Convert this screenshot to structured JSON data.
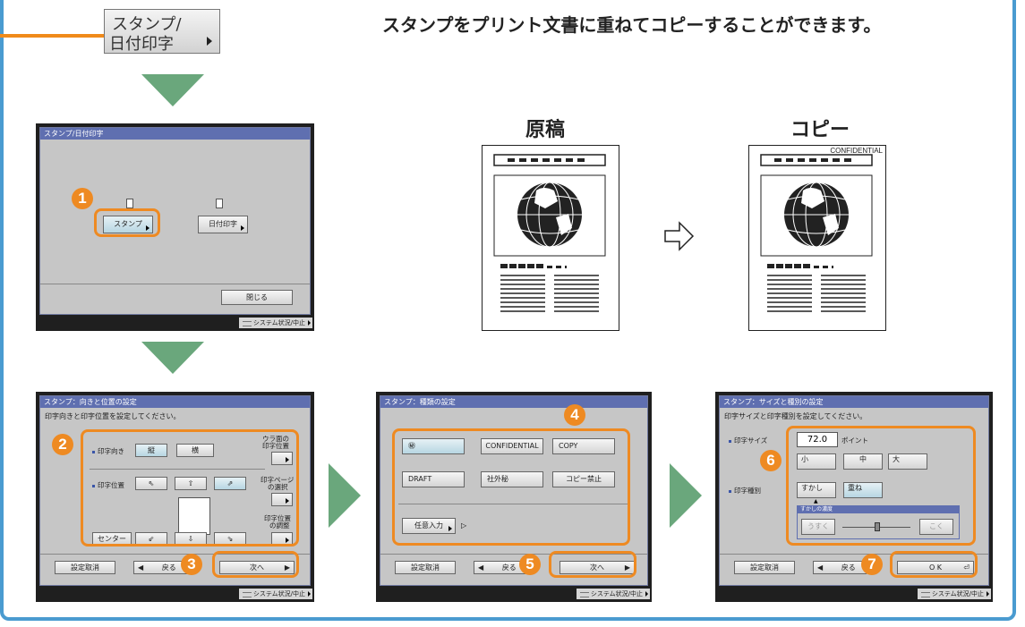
{
  "top": {
    "button_line1": "スタンプ/",
    "button_line2": "日付印字",
    "caption": "スタンプをプリント文書に重ねてコピーすることができます。"
  },
  "screen1": {
    "title": "スタンプ/日付印字",
    "stamp_button": "スタンプ",
    "date_button": "日付印字",
    "close_button": "閉じる",
    "system_status": "システム状況/中止"
  },
  "docs": {
    "original_label": "原稿",
    "copy_label": "コピー",
    "stamp_text": "CONFIDENTIAL"
  },
  "screen2": {
    "title": "スタンプ：向きと位置の設定",
    "instruction": "印字向きと印字位置を設定してください。",
    "orientation_label": "印字向き",
    "orientation_vertical": "縦",
    "orientation_horizontal": "横",
    "position_label": "印字位置",
    "center_button": "センター",
    "back_side_label_1": "ウラ面の",
    "back_side_label_2": "印字位置",
    "page_select_label_1": "印字ページ",
    "page_select_label_2": "の選択",
    "adjust_label_1": "印字位置",
    "adjust_label_2": "の調整",
    "cancel_button": "設定取消",
    "back_button": "戻る",
    "next_button": "次へ",
    "system_status": "システム状況/中止"
  },
  "screen3": {
    "title": "スタンプ：種類の設定",
    "options": [
      "㊙",
      "CONFIDENTIAL",
      "COPY",
      "DRAFT",
      "社外秘",
      "コピー禁止"
    ],
    "custom_button": "任意入力",
    "cancel_button": "設定取消",
    "back_button": "戻る",
    "next_button": "次へ",
    "system_status": "システム状況/中止"
  },
  "screen4": {
    "title": "スタンプ：サイズと種別の設定",
    "instruction": "印字サイズと印字種別を設定してください。",
    "size_label": "印字サイズ",
    "size_value": "72.0",
    "size_unit": "ポイント",
    "size_small": "小",
    "size_medium": "中",
    "size_large": "大",
    "type_label": "印字種別",
    "type_watermark": "すかし",
    "type_overlay": "重ね",
    "density_label": "すかしの濃度",
    "density_light": "うすく",
    "density_dark": "こく",
    "cancel_button": "設定取消",
    "back_button": "戻る",
    "ok_button": "O K",
    "system_status": "システム状況/中止"
  },
  "badges": [
    "1",
    "2",
    "3",
    "4",
    "5",
    "6",
    "7"
  ],
  "colors": {
    "accent_orange": "#ee8a22",
    "frame_blue": "#4a9bd0",
    "arrow_green": "#6aa77c",
    "title_bar": "#5f6fb0"
  }
}
